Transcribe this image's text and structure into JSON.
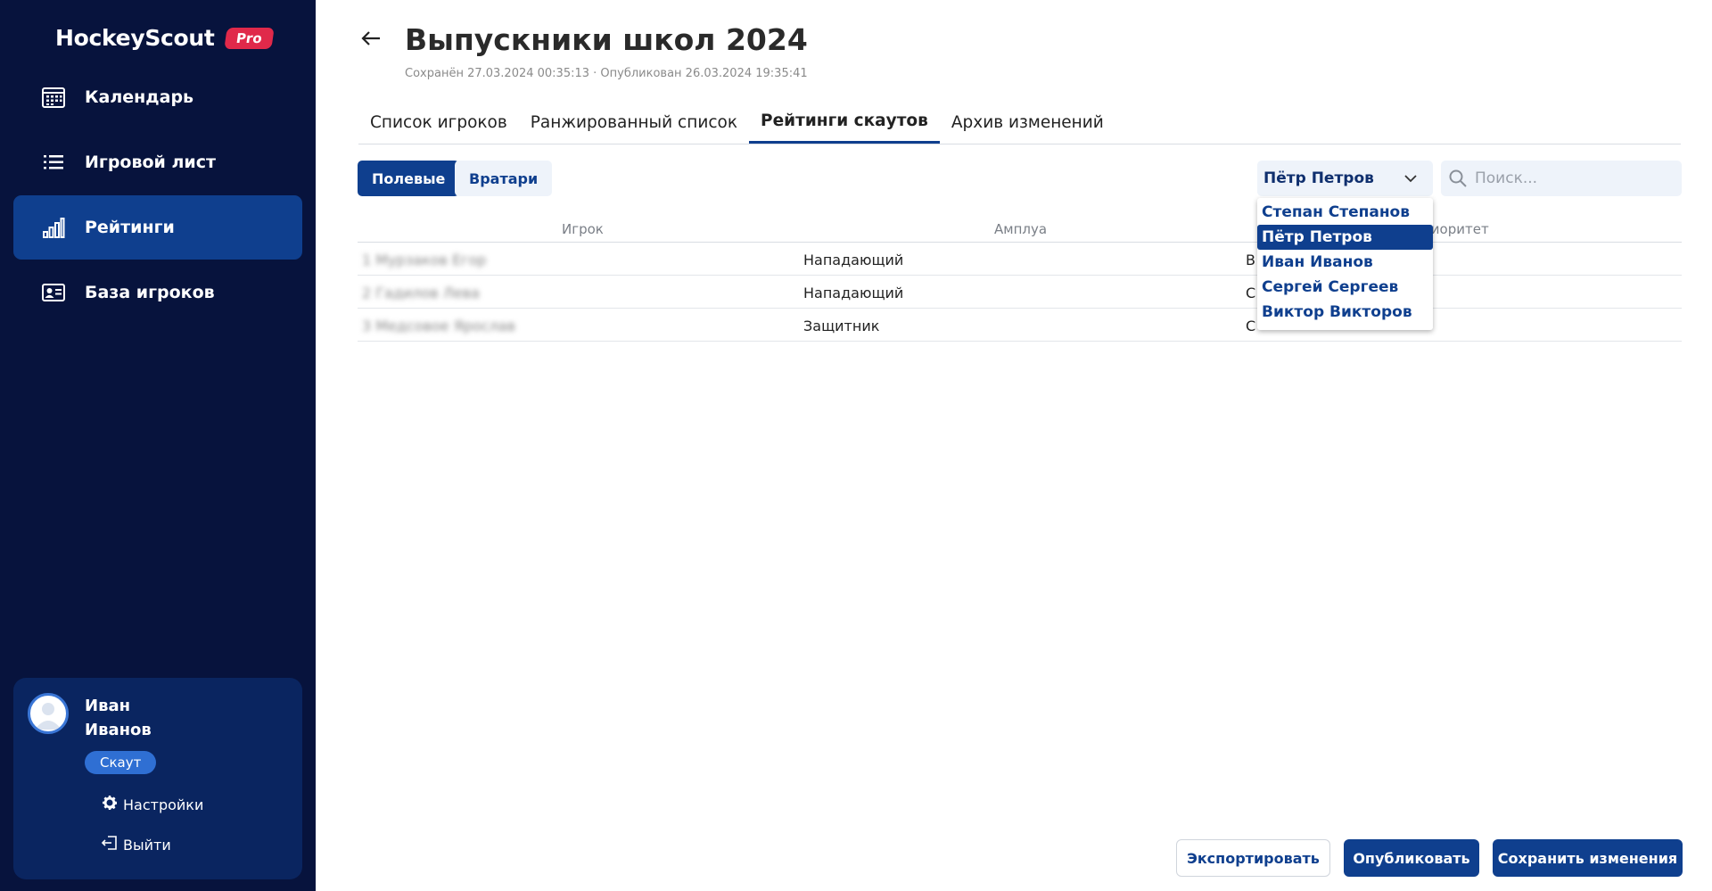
{
  "app": {
    "name": "HockeyScout",
    "badge": "Pro"
  },
  "sidebar": {
    "items": [
      {
        "label": "Календарь",
        "icon": "calendar-icon",
        "active": false
      },
      {
        "label": "Игровой лист",
        "icon": "list-icon",
        "active": false
      },
      {
        "label": "Рейтинги",
        "icon": "bar-chart-icon",
        "active": true
      },
      {
        "label": "База игроков",
        "icon": "id-card-icon",
        "active": false
      }
    ]
  },
  "user": {
    "first_name": "Иван",
    "last_name": "Иванов",
    "role": "Скаут",
    "settings_label": "Настройки",
    "logout_label": "Выйти"
  },
  "page": {
    "title": "Выпускники школ 2024",
    "meta": "Сохранён 27.03.2024 00:35:13 · Опубликован 26.03.2024 19:35:41"
  },
  "tabs": [
    {
      "label": "Список игроков",
      "active": false
    },
    {
      "label": "Ранжированный список",
      "active": false
    },
    {
      "label": "Рейтинги скаутов",
      "active": true
    },
    {
      "label": "Архив изменений",
      "active": false
    }
  ],
  "segments": {
    "field": "Полевые",
    "goalies": "Вратари",
    "active": "field"
  },
  "scout_select": {
    "value": "Пётр Петров",
    "options": [
      "Степан Степанов",
      "Пётр Петров",
      "Иван Иванов",
      "Сергей Сергеев",
      "Виктор Викторов"
    ]
  },
  "search": {
    "placeholder": "Поиск..."
  },
  "table": {
    "columns": [
      "Игрок",
      "Амплуа",
      "Приоритет"
    ],
    "rows": [
      {
        "player": "1 Мурзаков Егор",
        "position": "Нападающий",
        "priority": "В"
      },
      {
        "player": "2 Гадилов Лева",
        "position": "Нападающий",
        "priority": "С"
      },
      {
        "player": "3 Медсовое Ярослав",
        "position": "Защитник",
        "priority": "С"
      }
    ]
  },
  "footer": {
    "export": "Экспортировать",
    "publish": "Опубликовать",
    "save": "Сохранить изменения"
  },
  "colors": {
    "sidebar_bg": "#07133d",
    "accent": "#0f3f8e",
    "badge": "#e0294a"
  }
}
